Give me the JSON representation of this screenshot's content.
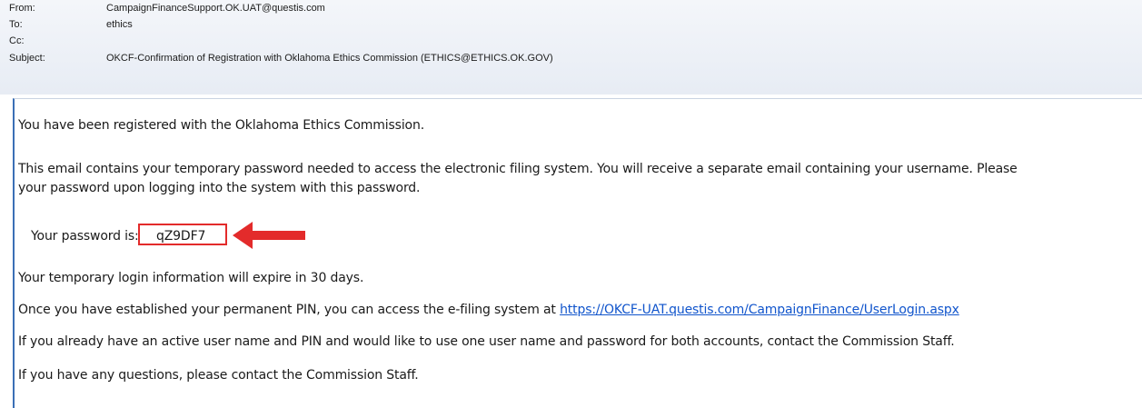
{
  "header": {
    "from_label": "From:",
    "from_value": "CampaignFinanceSupport.OK.UAT@questis.com",
    "to_label": "To:",
    "to_value": "ethics",
    "cc_label": "Cc:",
    "cc_value": "",
    "subject_label": "Subject:",
    "subject_value": "OKCF-Confirmation of Registration with Oklahoma Ethics Commission (ETHICS@ETHICS.OK.GOV)"
  },
  "body": {
    "line1": "You have been registered with the Oklahoma Ethics Commission.",
    "line2a": " This email contains your temporary password needed to access the electronic filing system. You will receive a separate email containing your username. Please",
    "line2b": "your password upon logging into the system with this password.",
    "pw_label": "Your password is:",
    "pw_value": "qZ9DF7",
    "line4": "Your temporary login information will expire in 30 days.",
    "line5": "Once you have established your permanent PIN, you can access the e-filing system at",
    "line5_link": "https://OKCF-UAT.questis.com/CampaignFinance/UserLogin.aspx",
    "line6": "If you already have an active user name and PIN and would like to use one user name and password for both  accounts, contact the Commission Staff.",
    "line7": "If you have any questions, please contact the Commission Staff."
  },
  "colors": {
    "highlight": "#e32b2b",
    "link": "#1155cc",
    "frame": "#3b6fb6"
  },
  "icons": {
    "annotation_arrow": "left-arrow-icon"
  }
}
